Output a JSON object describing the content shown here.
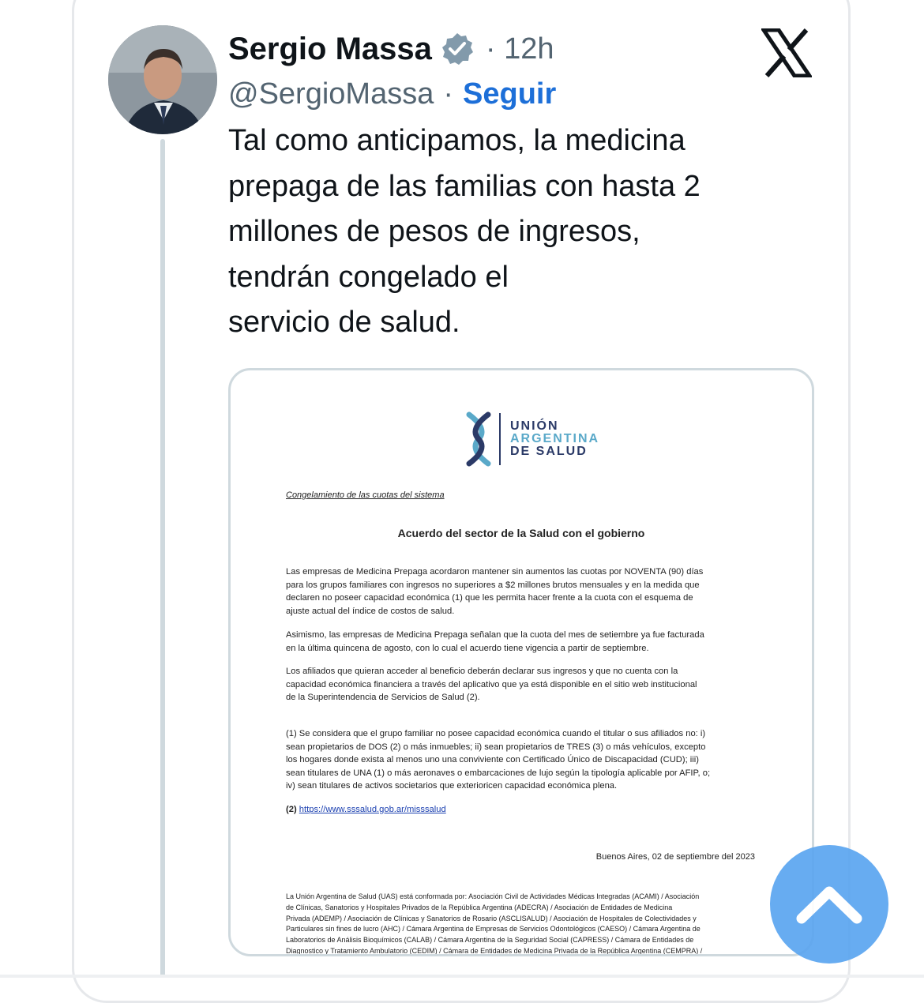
{
  "author": {
    "name": "Sergio Massa",
    "time": "· 12h",
    "handle": "@SergioMassa",
    "separator": "·",
    "follow_label": "Seguir"
  },
  "tweet": {
    "lines": [
      "Tal como anticipamos, la medicina",
      "prepaga de las familias con hasta 2",
      "millones de pesos de ingresos,",
      "tendrán congelado el",
      "servicio de salud."
    ]
  },
  "document": {
    "logo": {
      "line1": "UNIÓN",
      "line2": "ARGENTINA",
      "line3": "DE SALUD"
    },
    "subtitle": "Congelamiento de las cuotas del sistema",
    "title": "Acuerdo del sector de la Salud con el gobierno",
    "para1": [
      "Las empresas de Medicina Prepaga acordaron mantener sin aumentos las cuotas por NOVENTA (90) días",
      "para los grupos familiares con ingresos no superiores a $2 millones brutos mensuales y en la medida que",
      "declaren no poseer capacidad económica (1) que les permita hacer frente a la cuota con el esquema de",
      "ajuste actual del índice de costos de salud."
    ],
    "para2": [
      "Asimismo, las empresas de Medicina Prepaga señalan que la cuota del mes de setiembre ya fue facturada",
      "en la última quincena de agosto, con lo cual el acuerdo tiene vigencia a partir de septiembre."
    ],
    "para3": [
      "Los afiliados que quieran acceder al beneficio deberán declarar sus ingresos y que no cuenta con la",
      "capacidad económica financiera a través del aplicativo que ya está disponible en el sitio web institucional",
      "de la Superintendencia de Servicios de Salud (2)."
    ],
    "para4": [
      "(1) Se considera que el grupo familiar no posee capacidad económica cuando el titular o sus afiliados no: i)",
      "sean propietarios de DOS (2) o más inmuebles; ii) sean propietarios de TRES (3) o más vehículos, excepto",
      "los hogares donde exista al menos uno una conviviente con Certificado Único de Discapacidad (CUD); iii)",
      "sean titulares de UNA (1) o más aeronaves o embarcaciones de lujo según la tipología aplicable por AFIP, o;",
      "iv) sean titulares de activos societarios que exterioricen capacidad económica plena."
    ],
    "note2_prefix": "(2)",
    "note2_link": "https://www.sssalud.gob.ar/misssalud",
    "date": "Buenos Aires, 02 de septiembre del 2023",
    "fine_print": [
      "La Unión Argentina de Salud (UAS) está conformada por: Asociación Civil de Actividades Médicas Integradas (ACAMI) / Asociación",
      "de Clínicas, Sanatorios y Hospitales Privados de la República Argentina (ADECRA) / Asociación de Entidades de Medicina",
      "Privada (ADEMP) / Asociación de Clínicas y Sanatorios de Rosario (ASCLISALUD) / Asociación de Hospitales de Colectividades y",
      "Particulares sin fines de lucro (AHC) / Cámara Argentina de Empresas de Servicios Odontológicos (CAESO) / Cámara Argentina de",
      "Laboratorios de Análisis Bioquímicos (CALAB) / Cámara Argentina de la Seguridad Social (CAPRESS) / Cámara de Entidades de",
      "Diagnostico y Tratamiento Ambulatorio (CEDIM) / Cámara de Entidades de Medicina Privada de la República Argentina (CEMPRA) /"
    ]
  },
  "colors": {
    "follow": "#1d6fd8",
    "verified": "#829aab",
    "scroll_button": "#5ba5f0"
  },
  "icons": {
    "verified": "verified-badge-icon",
    "x_logo": "x-logo-icon",
    "scroll_top": "chevron-up-icon"
  }
}
